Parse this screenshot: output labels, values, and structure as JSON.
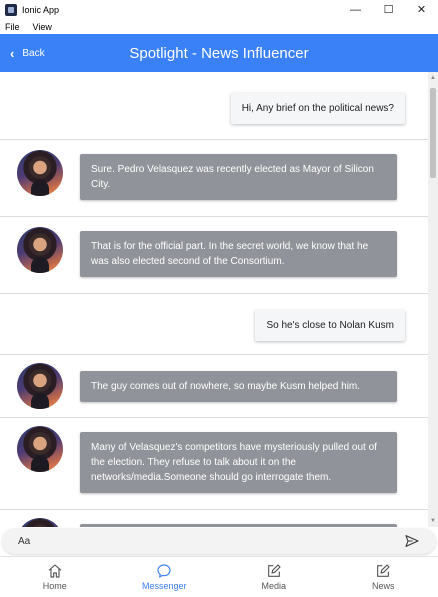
{
  "window": {
    "title": "Ionic App",
    "controls": {
      "minimize": "—",
      "maximize": "☐",
      "close": "✕"
    }
  },
  "menu": [
    "File",
    "View"
  ],
  "header": {
    "back_label": "Back",
    "title": "Spotlight - News Influencer",
    "color": "#3a80f6"
  },
  "messages": [
    {
      "from": "user",
      "text": "Hi, Any brief on the political news?"
    },
    {
      "from": "bot",
      "text": "Sure. Pedro Velasquez was recently elected as Mayor of Silicon City."
    },
    {
      "from": "bot",
      "text": "That is for the official part. In the secret world, we know that he was also elected second of the Consortium."
    },
    {
      "from": "user",
      "text": "So he's close to Nolan Kusm"
    },
    {
      "from": "bot",
      "text": "The guy comes out of nowhere, so maybe Kusm helped him."
    },
    {
      "from": "bot",
      "text": "Many of Velasquez's competitors have mysteriously pulled out of the election. They refuse to talk about it on the networks/media.Someone should go interrogate them."
    }
  ],
  "composer": {
    "placeholder": "Aa",
    "send_icon": "send-icon"
  },
  "tabs": [
    {
      "label": "Home",
      "icon": "home-icon",
      "active": false
    },
    {
      "label": "Messenger",
      "icon": "chat-icon",
      "active": true
    },
    {
      "label": "Media",
      "icon": "edit-icon",
      "active": false
    },
    {
      "label": "News",
      "icon": "edit-icon",
      "active": false
    }
  ]
}
